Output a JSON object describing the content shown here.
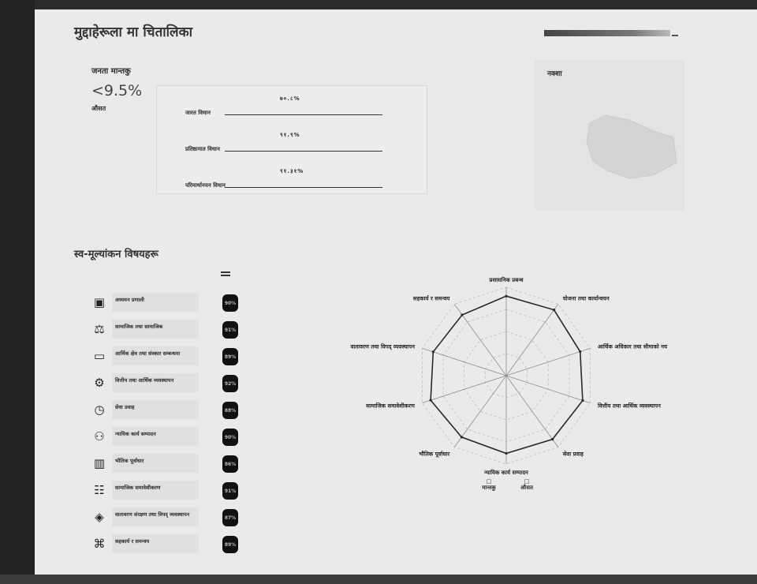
{
  "header": {
    "title": "मुद्दाहेरूला मा चितालिका"
  },
  "summary": {
    "label": "जनता मान्तकु",
    "score": "<9.5%",
    "sub": "औसत"
  },
  "stats": [
    {
      "label": "जारत\nविधान",
      "value": "७०.८%"
    },
    {
      "label": "प्रतिष्ठामात\nविधान",
      "value": "९१.९%"
    },
    {
      "label": "परिमार्थानयन\nविधान",
      "value": "९१.३१%"
    }
  ],
  "map": {
    "label": "नक्शा"
  },
  "section": {
    "title": "स्व-मूल्यांकन विषयहरू"
  },
  "subjects": [
    {
      "icon": "document-icon",
      "glyph": "▣",
      "label": "अध्ययन प्रणाली",
      "score": "90%"
    },
    {
      "icon": "balance-icon",
      "glyph": "⚖",
      "label": "सामाजिक तथा सामाजिक",
      "score": "91%"
    },
    {
      "icon": "monitor-icon",
      "glyph": "▭",
      "label": "आर्थिक क्षेत्र तथा संस्कार सम्बन्धमा",
      "score": "89%"
    },
    {
      "icon": "gear-icon",
      "glyph": "⚙",
      "label": "वित्तीय तथा आर्थिक व्यवस्थापन",
      "score": "92%"
    },
    {
      "icon": "clock-icon",
      "glyph": "◷",
      "label": "सेवा प्रवाह",
      "score": "88%"
    },
    {
      "icon": "people-icon",
      "glyph": "⚇",
      "label": "न्यायिक कार्य सम्पादन",
      "score": "90%"
    },
    {
      "icon": "building-icon",
      "glyph": "▥",
      "label": "भौतिक पूर्वाधार",
      "score": "86%"
    },
    {
      "icon": "group-icon",
      "glyph": "☷",
      "label": "सामाजिक समावेशीकरण",
      "score": "91%"
    },
    {
      "icon": "shield-icon",
      "glyph": "◈",
      "label": "वातावरण संरक्षण तथा विपद् व्यवस्थापन",
      "score": "87%"
    },
    {
      "icon": "network-icon",
      "glyph": "⌘",
      "label": "सहकार्य र समन्वय",
      "score": "89%"
    }
  ],
  "chart_data": {
    "type": "radar",
    "axes": [
      "प्रशासनिक प्रबन्ध",
      "योजना तथा कार्यान्वयन",
      "आर्थिक अधिकार तथा सीमाको नय",
      "वित्तीय तथा आर्थिक व्यवस्थापन",
      "सेवा प्रवाह",
      "न्यायिक कार्य सम्पादन",
      "भौतिक पूर्वाधार",
      "सामाजिक समावेशीकरण",
      "वातावरण तथा विपद् व्यवस्थापन",
      "सहकार्य र समन्वय"
    ],
    "max": 100,
    "series": [
      {
        "name": "मान्तकु",
        "values": [
          90,
          92,
          88,
          91,
          89,
          88,
          86,
          90,
          87,
          85
        ]
      }
    ],
    "grid": true,
    "legend": [
      {
        "name": "मान्तकु",
        "marker": "□"
      },
      {
        "name": "औसत",
        "marker": "□"
      }
    ]
  }
}
